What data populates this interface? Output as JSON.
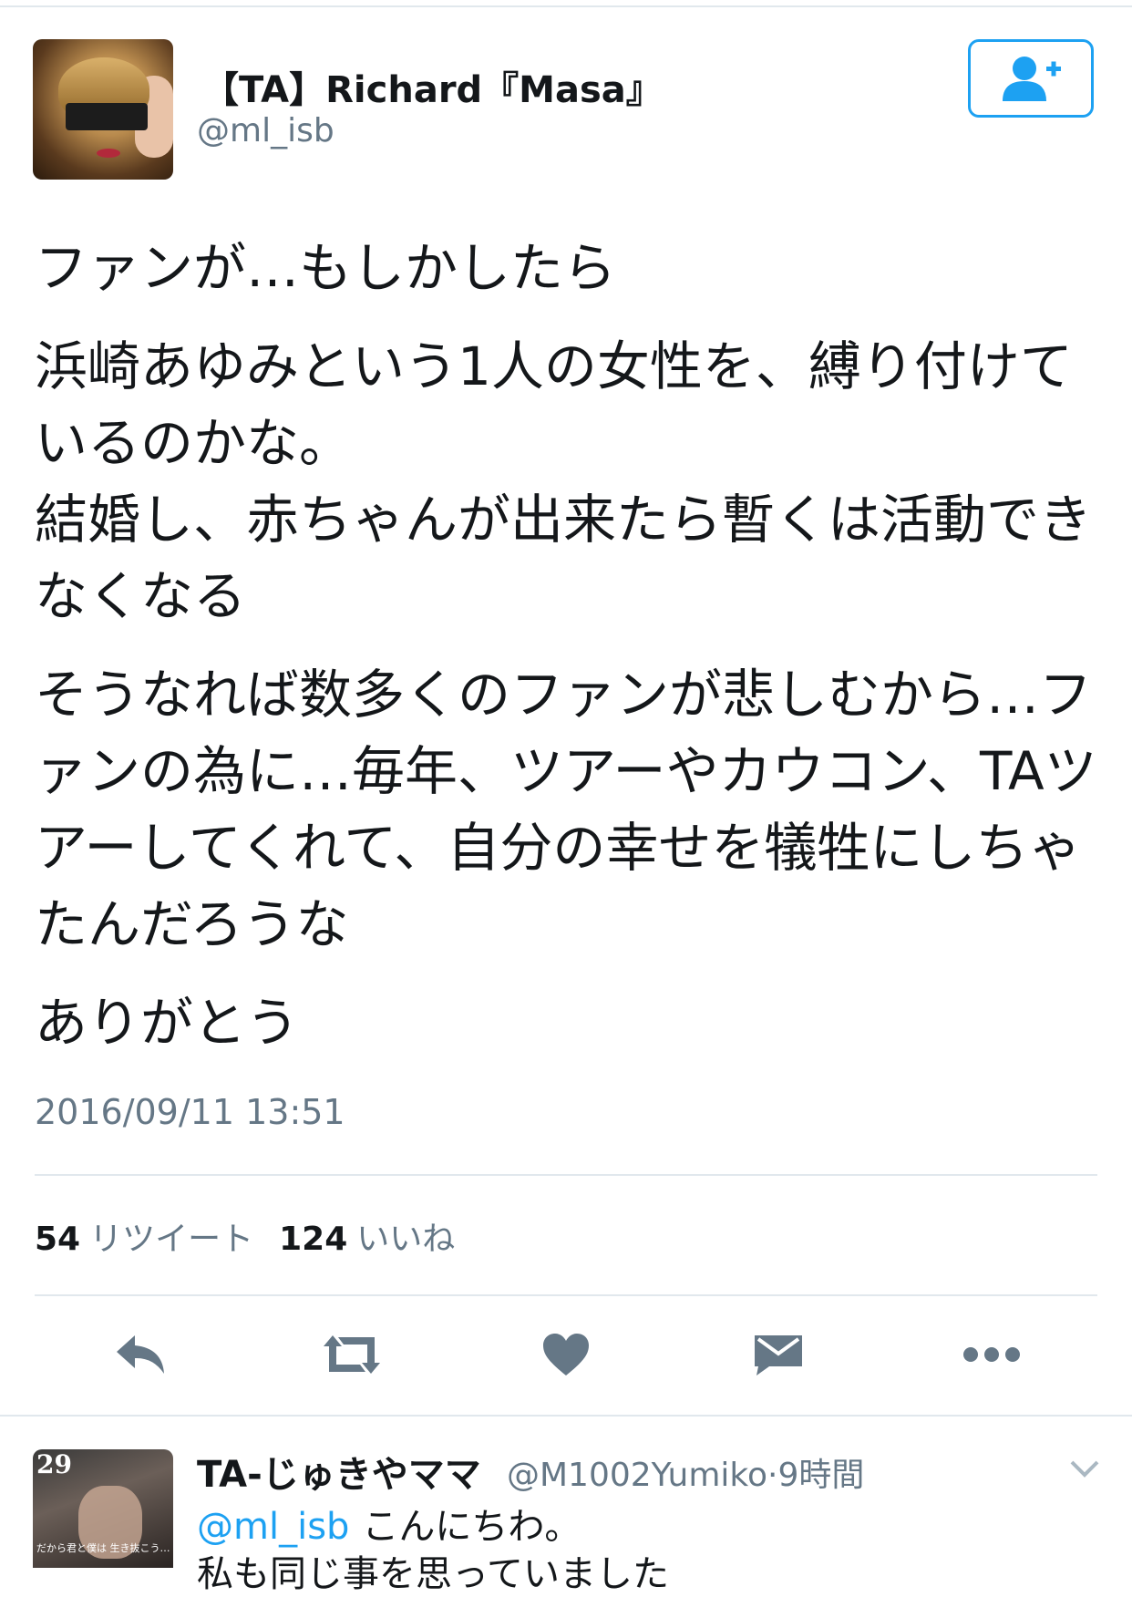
{
  "tweet": {
    "author": {
      "display_name": "【TA】Richard『Masa』",
      "handle": "@ml_isb",
      "avatar_icon": "profile-photo"
    },
    "follow_button_icon": "add-user-icon",
    "paragraphs": [
      "ファンが…もしかしたら",
      "浜崎あゆみという1人の女性を、縛り付けているのかな。\n結婚し、赤ちゃんが出来たら暫くは活動できなくなる",
      "そうなれば数多くのファンが悲しむから…ファンの為に…毎年、ツアーやカウコン、TAツアーしてくれて、自分の幸せを犠牲にしちゃたんだろうな",
      "ありがとう"
    ],
    "timestamp": "2016/09/11 13:51",
    "stats": {
      "retweet_count": "54",
      "retweet_label": "リツイート",
      "like_count": "124",
      "like_label": "いいね"
    },
    "actions": {
      "reply_icon": "reply-icon",
      "retweet_icon": "retweet-icon",
      "like_icon": "heart-icon",
      "dm_icon": "envelope-icon",
      "more_icon": "more-icon"
    }
  },
  "reply": {
    "display_name": "TA-じゅきやママ",
    "handle": "@M1002Yumiko",
    "separator": "·",
    "time": "9時間",
    "mention": "@ml_isb",
    "text": "こんにちわ。",
    "text_line2": "私も同じ事を思っていました",
    "avatar_number": "29",
    "avatar_caption": "だから君と僕は 生き抜こう…",
    "chevron_icon": "chevron-down-icon"
  },
  "colors": {
    "accent": "#1da1f2",
    "secondary_text": "#657786",
    "primary_text": "#14171a",
    "icon_gray": "#657786",
    "divider": "#e1e8ed"
  }
}
